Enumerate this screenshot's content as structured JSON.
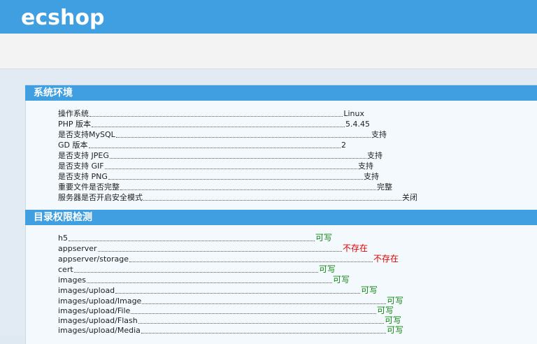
{
  "header": {
    "logo_text": "ecshop"
  },
  "sections": {
    "system": {
      "title": "系统环境",
      "rows": [
        {
          "label": "操作系统",
          "value": "Linux"
        },
        {
          "label": "PHP 版本",
          "value": "5.4.45"
        },
        {
          "label": "是否支持MySQL",
          "value": "支持"
        },
        {
          "label": "GD 版本",
          "value": "2"
        },
        {
          "label": "是否支持 JPEG",
          "value": "支持"
        },
        {
          "label": "是否支持 GIF",
          "value": "支持"
        },
        {
          "label": "是否支持 PNG",
          "value": "支持"
        },
        {
          "label": "重要文件是否完整",
          "value": "完整"
        },
        {
          "label": "服务器是否开启安全模式",
          "value": "关闭"
        }
      ]
    },
    "dirs": {
      "title": "目录权限检测",
      "rows": [
        {
          "label": "h5",
          "value": "可写",
          "status": "ok"
        },
        {
          "label": "appserver",
          "value": "不存在",
          "status": "bad"
        },
        {
          "label": "appserver/storage",
          "value": "不存在",
          "status": "bad"
        },
        {
          "label": "cert",
          "value": "可写",
          "status": "ok"
        },
        {
          "label": "images",
          "value": "可写",
          "status": "ok"
        },
        {
          "label": "images/upload",
          "value": "可写",
          "status": "ok"
        },
        {
          "label": "images/upload/Image",
          "value": "可写",
          "status": "ok"
        },
        {
          "label": "images/upload/File",
          "value": "可写",
          "status": "ok"
        },
        {
          "label": "images/upload/Flash",
          "value": "可写",
          "status": "ok"
        },
        {
          "label": "images/upload/Media",
          "value": "可写",
          "status": "ok"
        }
      ]
    }
  },
  "colors": {
    "accent": "#3f9fe0",
    "ok": "#118811",
    "bad": "#dd0000"
  }
}
